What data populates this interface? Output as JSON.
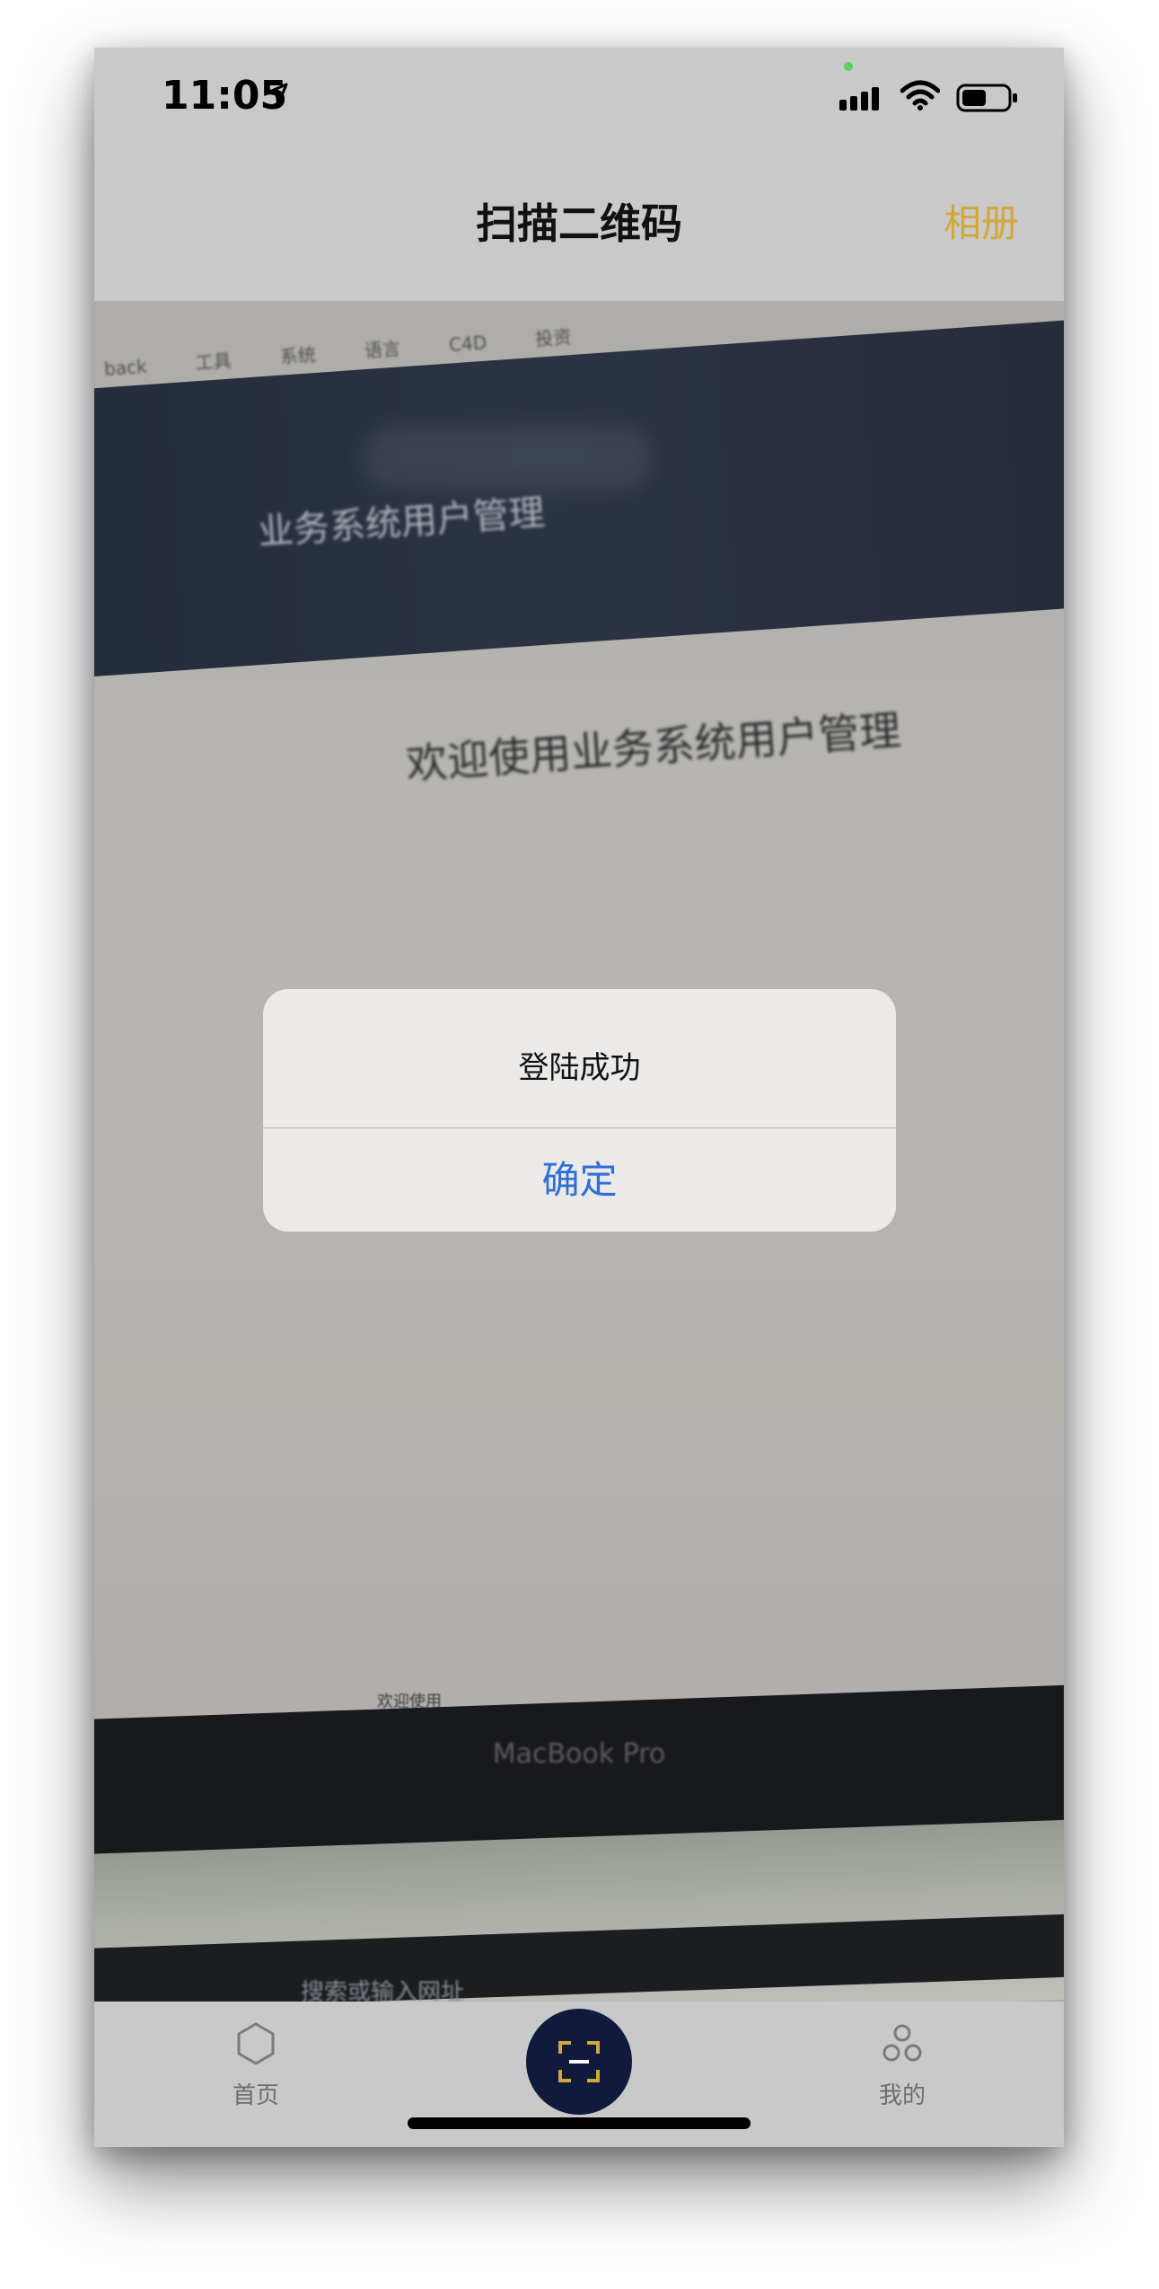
{
  "status_bar": {
    "time": "11:05"
  },
  "nav": {
    "title": "扫描二维码",
    "album": "相册"
  },
  "camera_view": {
    "bookmarks": [
      "back",
      "工具",
      "系统",
      "语言",
      "C4D",
      "投资"
    ],
    "header_text": "业务系统用户管理",
    "welcome_text": "欢迎使用业务系统用户管理",
    "footer_text": "欢迎使用",
    "device_label": "MacBook Pro",
    "touchbar_text": "搜索或输入网址"
  },
  "alert": {
    "message": "登陆成功",
    "confirm": "确定"
  },
  "tabbar": {
    "home": "首页",
    "mine": "我的"
  },
  "colors": {
    "accent_gold": "#d2a83a",
    "alert_button_blue": "#2f6fd6",
    "scan_button_navy": "#101a3c"
  }
}
